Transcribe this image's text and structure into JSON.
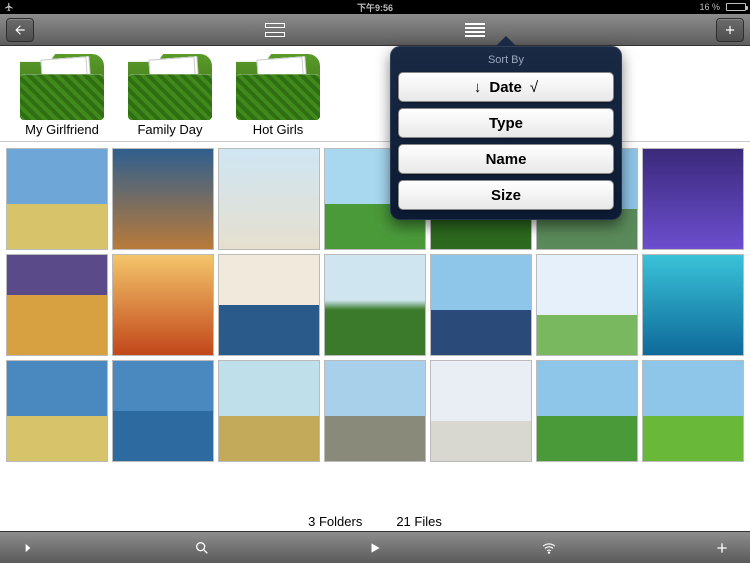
{
  "status": {
    "time": "下午9:56",
    "battery_pct": "16 %",
    "battery_fill_pct": 16
  },
  "folders": [
    {
      "label": "My Girlfriend"
    },
    {
      "label": "Family Day"
    },
    {
      "label": "Hot Girls"
    }
  ],
  "thumbs_count": 21,
  "footer": {
    "folders_text": "3 Folders",
    "files_text": "21 Files"
  },
  "sort_popover": {
    "title": "Sort By",
    "options": [
      {
        "prefix": "↓",
        "label": "Date",
        "suffix": "√",
        "selected": true
      },
      {
        "prefix": "",
        "label": "Type",
        "suffix": ""
      },
      {
        "prefix": "",
        "label": "Name",
        "suffix": ""
      },
      {
        "prefix": "",
        "label": "Size",
        "suffix": ""
      }
    ]
  },
  "thumb_gradients": [
    "linear-gradient(#6ea6d8 55%, #d7c46a 55%)",
    "linear-gradient(#2f5f8e, #b97a3a)",
    "linear-gradient(#cfe6f3, #e6dfcf)",
    "linear-gradient(#a8d8f0 55%, #4a9a3a 55%)",
    "linear-gradient(#4a88c0 55%, #2d6a1f 55%)",
    "linear-gradient(#8fc4e6 60%, #5a8a5a 60%)",
    "linear-gradient(#3a2a7a, #6c4ecf)",
    "linear-gradient(#5a4a8a 40%, #d7a040 40%)",
    "linear-gradient(#f3c56a, #c2471a)",
    "linear-gradient(#f0e9dc 50%, #2a5a8a 50%)",
    "linear-gradient(#cfe6f0 45%, #3a7a2a 55%)",
    "linear-gradient(#8ec6ea 55%, #2a4a7a 55%)",
    "linear-gradient(#e6f0fa 60%, #7ab860 60%)",
    "linear-gradient(#3ac2d8, #0e6a9a)",
    "linear-gradient(#4a88c0 55%, #d7c46a 55%)",
    "linear-gradient(#4a88c0 50%, #2d6aa0 50%)",
    "linear-gradient(#bfe0ea 55%, #c2aa5a 55%)",
    "linear-gradient(#a8d0ea 55%, #8a8a7a 55%)",
    "linear-gradient(#e8eef4 60%, #d8d8d0 60%)",
    "linear-gradient(#8ec6ea 55%, #4a9a3a 55%)",
    "linear-gradient(#8ec6ea 55%, #6ab83a 55%)"
  ]
}
